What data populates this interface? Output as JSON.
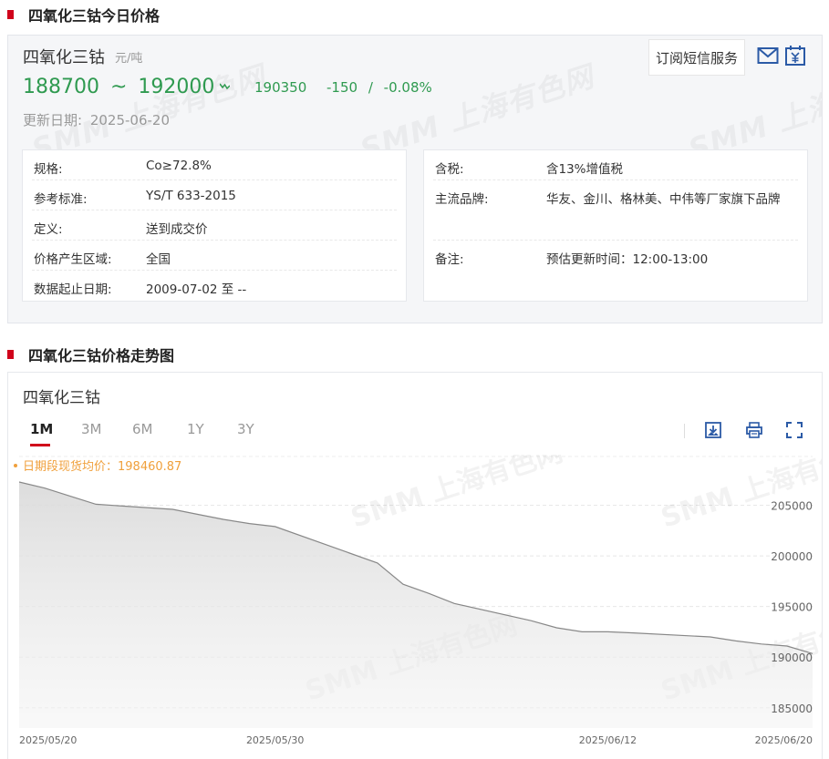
{
  "section1": {
    "title": "四氧化三钴今日价格"
  },
  "product": {
    "name": "四氧化三钴",
    "unit": "元/吨",
    "price_low": "188700",
    "tilde": "~",
    "price_high": "192000",
    "average": "190350",
    "change": "-150",
    "change_sep": "/",
    "change_pct": "-0.08%",
    "update_label": "更新日期:",
    "update_date": "2025-06-20"
  },
  "subscribe": {
    "label": "订阅短信服务"
  },
  "specs_left": [
    {
      "key": "规格:",
      "value": "Co≥72.8%"
    },
    {
      "key": "参考标准:",
      "value": "YS/T 633-2015"
    },
    {
      "key": "定义:",
      "value": "送到成交价"
    },
    {
      "key": "价格产生区域:",
      "value": "全国"
    },
    {
      "key": "数据起止日期:",
      "value": "2009-07-02 至 --"
    }
  ],
  "specs_right": [
    {
      "key": "含税:",
      "value": "含13%增值税"
    },
    {
      "key": "主流品牌:",
      "value": "华友、金川、格林美、中伟等厂家旗下品牌"
    },
    {
      "key": "备注:",
      "value": "预估更新时间：12:00-13:00"
    }
  ],
  "section2": {
    "title": "四氧化三钴价格走势图"
  },
  "chart_header": {
    "name": "四氧化三钴",
    "tabs": [
      "1M",
      "3M",
      "6M",
      "1Y",
      "3Y"
    ],
    "active_tab": "1M"
  },
  "watermark": {
    "text": "SMM 上海有色网",
    "text_short": "上海有色网"
  },
  "colors": {
    "accent_red": "#d0021b",
    "price_green": "#2f9a50",
    "avg_orange": "#f0a03c",
    "line": "#888888"
  },
  "chart_data": {
    "type": "area",
    "avg_label": "日期段现货均价：198460.87",
    "x": [
      "2025-05-20",
      "2025-05-21",
      "2025-05-22",
      "2025-05-23",
      "2025-05-26",
      "2025-05-27",
      "2025-05-28",
      "2025-05-29",
      "2025-05-30",
      "2025-06-03",
      "2025-06-04",
      "2025-06-05",
      "2025-06-06",
      "2025-06-09",
      "2025-06-10",
      "2025-06-11",
      "2025-06-12",
      "2025-06-13",
      "2025-06-16",
      "2025-06-17",
      "2025-06-18",
      "2025-06-19",
      "2025-06-20"
    ],
    "values": [
      207300,
      206700,
      205900,
      205100,
      204600,
      204100,
      203600,
      203200,
      202900,
      199300,
      197200,
      196300,
      195300,
      193600,
      192900,
      192500,
      192500,
      192400,
      192000,
      191600,
      191300,
      191100,
      190350
    ],
    "x_tick_labels": [
      "2025/05/20",
      "2025/05/30",
      "2025/06/12",
      "2025/06/20"
    ],
    "x_tick_dates": [
      "2025-05-20",
      "2025-05-30",
      "2025-06-12",
      "2025-06-20"
    ],
    "y_ticks": [
      185000,
      190000,
      195000,
      200000,
      205000
    ],
    "ylim": [
      183000,
      210000
    ],
    "grid": true
  }
}
